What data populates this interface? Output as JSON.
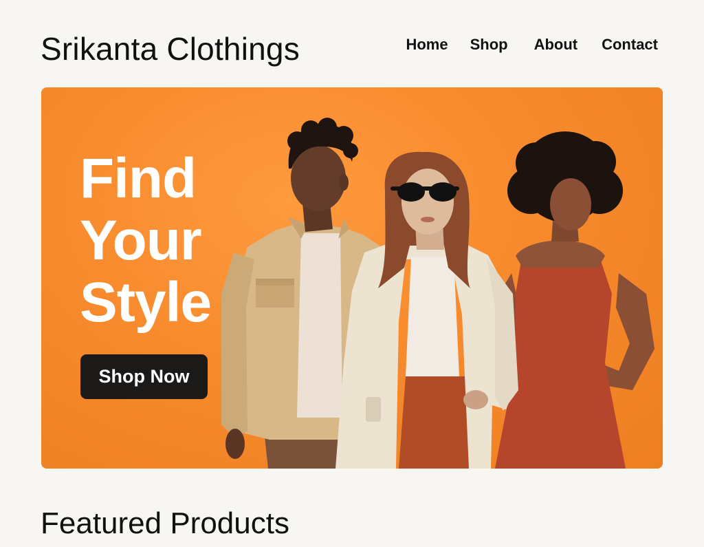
{
  "brand": "Srikanta Clothings",
  "nav": {
    "home": "Home",
    "shop": "Shop",
    "about": "About",
    "contact": "Contact"
  },
  "hero": {
    "title_lines": [
      "Find",
      "Your",
      "Style"
    ],
    "cta": "Shop Now",
    "image": "three-models-photo",
    "colors": {
      "background": "#f78a2c",
      "title": "#ffffff",
      "cta_background": "#1c1a19"
    }
  },
  "featured": {
    "title": "Featured Products"
  }
}
